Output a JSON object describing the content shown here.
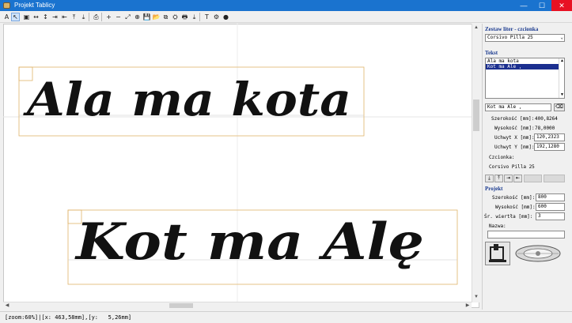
{
  "window": {
    "title": "Projekt Tablicy",
    "minimize": "—",
    "maximize": "☐",
    "close": "✕"
  },
  "toolbar": {
    "buttons": [
      {
        "name": "text-tool-icon",
        "glyph": "A"
      },
      {
        "name": "pointer-tool-icon",
        "glyph": "↖"
      },
      {
        "name": "select-frame-icon",
        "glyph": "▣"
      },
      {
        "name": "move-horizontal-icon",
        "glyph": "↔"
      },
      {
        "name": "move-vertical-icon",
        "glyph": "↕"
      },
      {
        "name": "align-right-icon",
        "glyph": "⇥"
      },
      {
        "name": "align-left-icon",
        "glyph": "⇤"
      },
      {
        "name": "align-top-icon",
        "glyph": "⤒"
      },
      {
        "name": "align-bottom-icon",
        "glyph": "⤓"
      },
      {
        "name": "print-icon",
        "glyph": "⎙"
      },
      {
        "name": "zoom-in-icon",
        "glyph": "+"
      },
      {
        "name": "zoom-out-icon",
        "glyph": "−"
      },
      {
        "name": "zoom-fit-icon",
        "glyph": "⤢"
      },
      {
        "name": "zoom-window-icon",
        "glyph": "⊕"
      },
      {
        "name": "save-icon",
        "glyph": "💾"
      },
      {
        "name": "open-folder-icon",
        "glyph": "📂"
      },
      {
        "name": "copy-icon",
        "glyph": "⧉"
      },
      {
        "name": "drill-icon",
        "glyph": "⛭"
      },
      {
        "name": "printer-icon",
        "glyph": "🖶"
      },
      {
        "name": "export-icon",
        "glyph": "⤓"
      },
      {
        "name": "text-settings-icon",
        "glyph": "T"
      },
      {
        "name": "tool-settings-icon",
        "glyph": "⚙"
      },
      {
        "name": "options-icon",
        "glyph": "●"
      }
    ]
  },
  "canvas": {
    "line1": "Ala ma kota",
    "line2": "Kot ma Alę"
  },
  "status": {
    "text": "[zoom:60%]|[x: 463,58mm],[y:   5,26mm]"
  },
  "panel": {
    "font_section": "Zestaw liter - czcionka",
    "font_combo": "Corsivo Pilla 25",
    "text_section": "Tekst",
    "text_items": [
      "Ala ma kota",
      "Kot ma Ale ,"
    ],
    "selected_index": 1,
    "edit_value": "Kot ma Ale ,",
    "width_label": "Szerokość [mm]:",
    "width_value": "400,8264",
    "height_label": "Wysokość [mm]:",
    "height_value": "78,0000",
    "anchor_x_label": "Uchwyt X [mm]:",
    "anchor_x_value": "120,2323",
    "anchor_y_label": "Uchwyt Y [mm]:",
    "anchor_y_value": "192,1280",
    "font_label": "Czcionka:",
    "font_name": "Corsivo Pilla 25",
    "project_section": "Projekt",
    "proj_width_label": "Szerokość [mm]:",
    "proj_width_value": "800",
    "proj_height_label": "Wysokość [mm]:",
    "proj_height_value": "600",
    "drill_label": "Śr. wiertła [mm]:",
    "drill_value": "3",
    "name_label": "Nazwa:",
    "name_value": ""
  }
}
